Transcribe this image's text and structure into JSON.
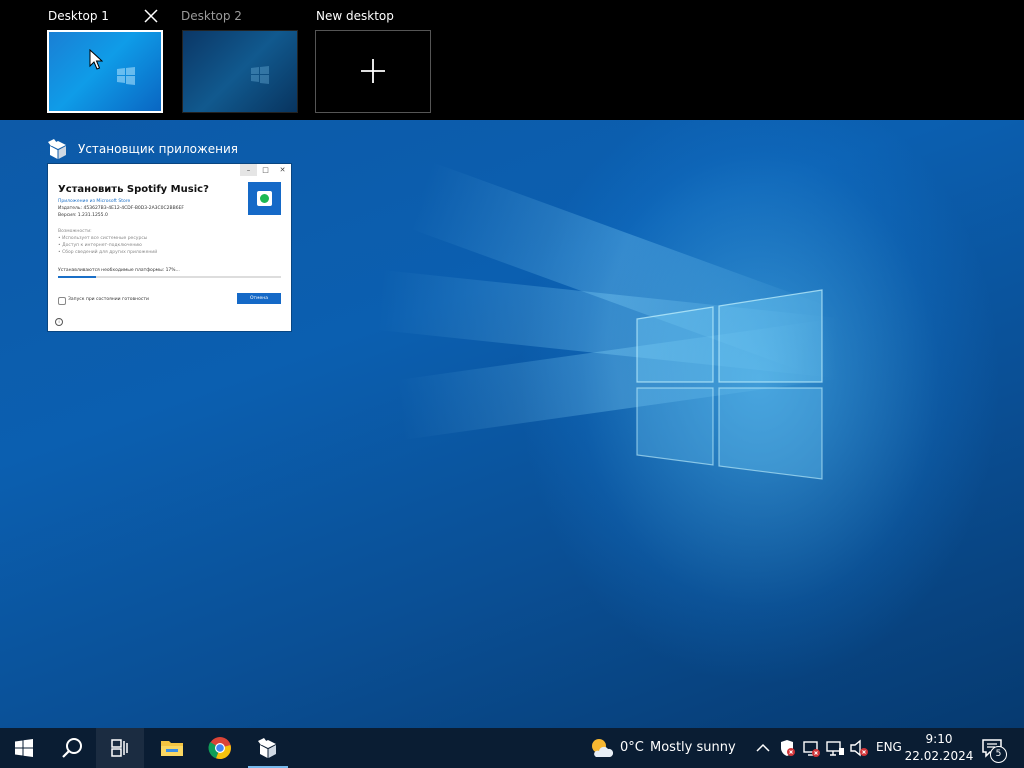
{
  "virtual_desktops": {
    "items": [
      {
        "label": "Desktop 1",
        "active": true
      },
      {
        "label": "Desktop 2",
        "active": false
      }
    ],
    "new_desktop_label": "New desktop"
  },
  "window_preview": {
    "app_title": "Установщик приложения",
    "controls": [
      "–",
      "□",
      "✕"
    ],
    "heading": "Установить Spotify Music?",
    "store_link": "Приложение из Microsoft Store",
    "publisher": "Издатель: 453627B3-4E12-4CDF-B0D3-2A3C0C2BB6EF",
    "version": "Версия: 1.231.1255.0",
    "capabilities_title": "Возможности:",
    "capabilities": [
      "• Использует все системные ресурсы",
      "• Доступ к интернет-подключению",
      "• Сбор сведений для других приложений"
    ],
    "status": "Устанавливаются необходимые платформы: 17%...",
    "progress": 0.17,
    "launch_checkbox_label": "Запуск при состоянии готовности",
    "cancel_label": "Отмена",
    "info_icon": "i"
  },
  "taskbar": {
    "weather_temp": "0°C",
    "weather_text": "Mostly sunny",
    "language": "ENG",
    "time": "9:10",
    "date": "22.02.2024",
    "notification_count": "5"
  },
  "colors": {
    "accent": "#1569c7",
    "spotify_green": "#1db954",
    "taskbar_bg": "#0a1d33"
  }
}
